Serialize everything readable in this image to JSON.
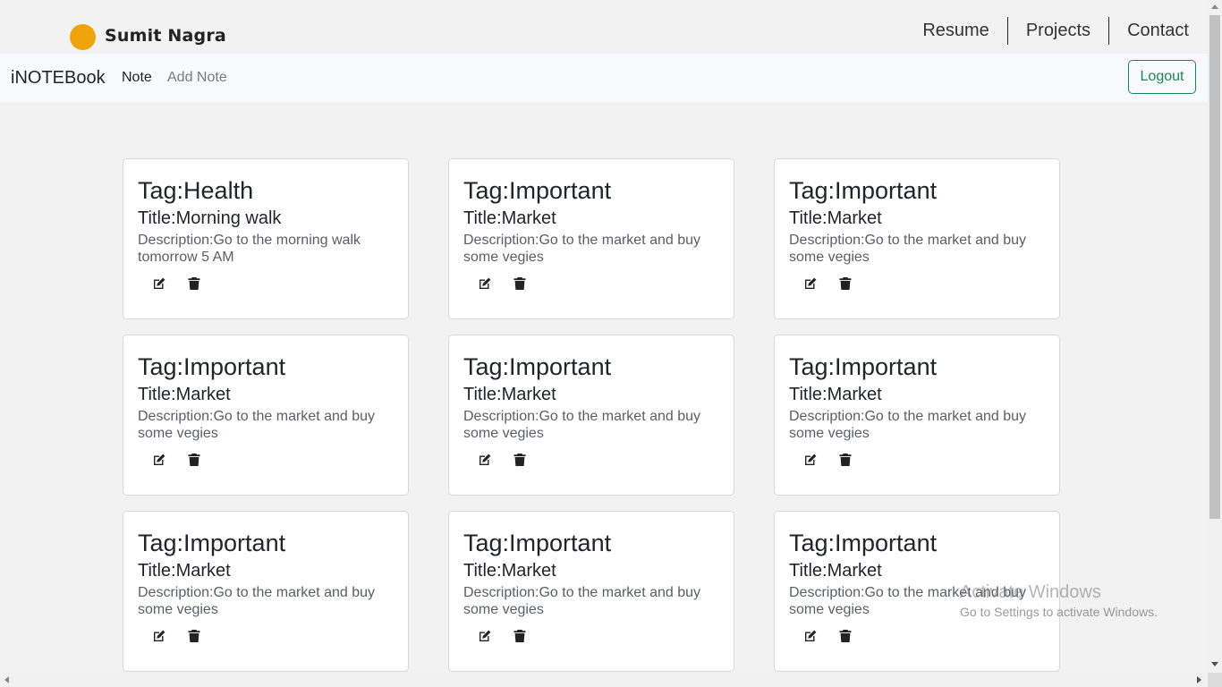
{
  "header": {
    "brand_name": "Sumit Nagra",
    "nav": [
      {
        "label": "Resume"
      },
      {
        "label": "Projects"
      },
      {
        "label": "Contact"
      }
    ]
  },
  "navbar": {
    "brand": "iNOTEBook",
    "links": [
      {
        "label": "Note",
        "active": true
      },
      {
        "label": "Add Note",
        "active": false
      }
    ],
    "logout_label": "Logout"
  },
  "notes": [
    {
      "tag": "Tag:Health",
      "title": "Title:Morning walk",
      "description": "Description:Go to the morning walk tomorrow 5 AM"
    },
    {
      "tag": "Tag:Important",
      "title": "Title:Market",
      "description": "Description:Go to the market and buy some vegies"
    },
    {
      "tag": "Tag:Important",
      "title": "Title:Market",
      "description": "Description:Go to the market and buy some vegies"
    },
    {
      "tag": "Tag:Important",
      "title": "Title:Market",
      "description": "Description:Go to the market and buy some vegies"
    },
    {
      "tag": "Tag:Important",
      "title": "Title:Market",
      "description": "Description:Go to the market and buy some vegies"
    },
    {
      "tag": "Tag:Important",
      "title": "Title:Market",
      "description": "Description:Go to the market and buy some vegies"
    },
    {
      "tag": "Tag:Important",
      "title": "Title:Market",
      "description": "Description:Go to the market and buy some vegies"
    },
    {
      "tag": "Tag:Important",
      "title": "Title:Market",
      "description": "Description:Go to the market and buy some vegies"
    },
    {
      "tag": "Tag:Important",
      "title": "Title:Market",
      "description": "Description:Go to the market and buy some vegies"
    }
  ],
  "note_actions": {
    "edit_icon": "edit-icon",
    "delete_icon": "trash-icon"
  },
  "watermark": {
    "title": "Activate Windows",
    "subtitle": "Go to Settings to activate Windows."
  },
  "colors": {
    "brand_dot": "#f0a30a",
    "logout_accent": "#198754",
    "page_background": "#f2f2f2",
    "navbar_background": "#f8f9fa"
  }
}
